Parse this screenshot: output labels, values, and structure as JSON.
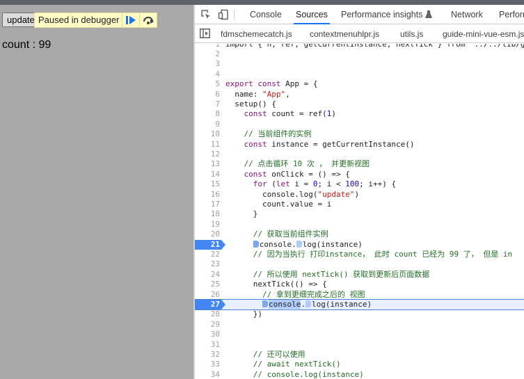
{
  "page": {
    "update_button": "update",
    "paused_label": "Paused in debugger",
    "count_text": "count : 99"
  },
  "devtools": {
    "tabs": [
      "Console",
      "Sources",
      "Performance insights",
      "Network",
      "Performance"
    ],
    "active_tab": "Sources",
    "files": [
      "fdmschemecatch.js",
      "contextmenuhlpr.js",
      "utils.js",
      "guide-mini-vue-esm.js"
    ]
  },
  "code": {
    "first_line_partial": "import { h, ref, getCurrentInstance, nextTick } from \"../../lib/g",
    "breakpoint_lines": [
      21,
      27
    ],
    "current_line": 27,
    "lines": [
      {
        "n": "2",
        "t": ""
      },
      {
        "n": "3",
        "t": ""
      },
      {
        "n": "4",
        "t": ""
      },
      {
        "n": "5",
        "t": "export const App = {"
      },
      {
        "n": "6",
        "t": "  name: \"App\","
      },
      {
        "n": "7",
        "t": "  setup() {"
      },
      {
        "n": "8",
        "t": "    const count = ref(1)"
      },
      {
        "n": "9",
        "t": ""
      },
      {
        "n": "10",
        "t": "    // 当前组件的实例"
      },
      {
        "n": "11",
        "t": "    const instance = getCurrentInstance()"
      },
      {
        "n": "12",
        "t": ""
      },
      {
        "n": "13",
        "t": "    // 点击循环 10 次 ， 并更新视图"
      },
      {
        "n": "14",
        "t": "    const onClick = () => {"
      },
      {
        "n": "15",
        "t": "      for (let i = 0; i < 100; i++) {"
      },
      {
        "n": "16",
        "t": "        console.log(\"update\")"
      },
      {
        "n": "17",
        "t": "        count.value = i"
      },
      {
        "n": "18",
        "t": "      }"
      },
      {
        "n": "19",
        "t": ""
      },
      {
        "n": "20",
        "t": "      // 获取当前组件实例"
      },
      {
        "n": "21",
        "t": "      console.log(instance)"
      },
      {
        "n": "22",
        "t": "      // 因为当执行 打印instance， 此时 count 已经为 99 了， 但是 in"
      },
      {
        "n": "23",
        "t": ""
      },
      {
        "n": "24",
        "t": "      // 所以使用 nextTick() 获取到更新后页面数据"
      },
      {
        "n": "25",
        "t": "      nextTick(() => {"
      },
      {
        "n": "26",
        "t": "        // 拿到更细完成之后的 视图"
      },
      {
        "n": "27",
        "t": "        console.log(instance)"
      },
      {
        "n": "28",
        "t": "      })"
      },
      {
        "n": "29",
        "t": ""
      },
      {
        "n": "30",
        "t": ""
      },
      {
        "n": "31",
        "t": ""
      },
      {
        "n": "32",
        "t": "      // 还可以使用"
      },
      {
        "n": "33",
        "t": "      // await nextTick()"
      },
      {
        "n": "34",
        "t": "      // console.log(instance)"
      }
    ]
  },
  "colors": {
    "page_overlay": "#a9a9a9",
    "paused_bg": "#fffbc4",
    "breakpoint": "#4285f4",
    "active_tab_underline": "#1a73e8",
    "keyword": "#881280",
    "string": "#c41a16",
    "number": "#1c00cf",
    "comment": "#236e25"
  },
  "icons": {
    "resume": "resume-icon",
    "step_over": "step-over-icon",
    "inspect": "inspect-element-icon",
    "device": "device-toolbar-icon",
    "flask": "flask-icon",
    "navigator": "navigator-toggle-icon"
  }
}
